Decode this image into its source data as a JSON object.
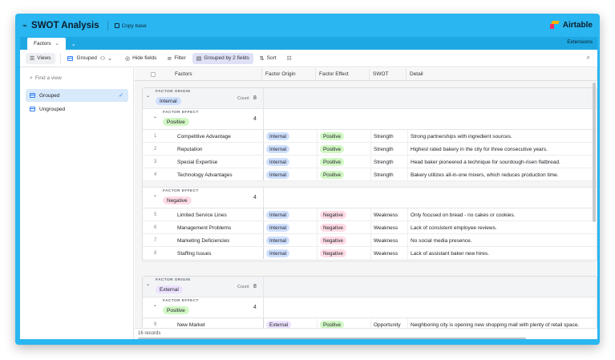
{
  "colors": {
    "header_bg": "#2ab6f0",
    "internal_pill": "#cfe0fe",
    "external_pill": "#ede2fe",
    "positive_pill": "#d1f7c4",
    "negative_pill": "#ffdce5"
  },
  "header": {
    "base_icon": "⌁",
    "title": "SWOT Analysis",
    "copy_base": "Copy base",
    "brand": "Airtable"
  },
  "tabs": {
    "active": "Factors",
    "more_icon": "chevron-down-icon",
    "extensions": "Extensions"
  },
  "toolbar": {
    "views": "Views",
    "view_name": "Grouped",
    "hide_fields": "Hide fields",
    "filter": "Filter",
    "group": "Grouped by 2 fields",
    "sort": "Sort"
  },
  "sidebar": {
    "search_placeholder": "Find a view",
    "views": [
      {
        "label": "Grouped",
        "active": true
      },
      {
        "label": "Ungrouped",
        "active": false
      }
    ]
  },
  "columns": [
    "Factors",
    "Factor Origin",
    "Factor Effect",
    "SWOT",
    "Detail"
  ],
  "groups": [
    {
      "label": "FACTOR ORIGIN",
      "value": "Internal",
      "count_label": "Count",
      "count": "8",
      "subgroups": [
        {
          "label": "FACTOR EFFECT",
          "value": "Positive",
          "count": "4",
          "rows": [
            {
              "n": "1",
              "factor": "Competitive Advantage",
              "origin": "Internal",
              "effect": "Positive",
              "swot": "Strength",
              "detail": "Strong partnerships with ingredient sources."
            },
            {
              "n": "2",
              "factor": "Reputation",
              "origin": "Internal",
              "effect": "Positive",
              "swot": "Strength",
              "detail": "Highest rated bakery in the city for three consecutive years."
            },
            {
              "n": "3",
              "factor": "Special Expertise",
              "origin": "Internal",
              "effect": "Positive",
              "swot": "Strength",
              "detail": "Head baker pioneered a technique for sourdough-risen flatbread."
            },
            {
              "n": "4",
              "factor": "Technology Advantages",
              "origin": "Internal",
              "effect": "Positive",
              "swot": "Strength",
              "detail": "Bakery utilizes all-in-one mixers, which reduces production time."
            }
          ]
        },
        {
          "label": "FACTOR EFFECT",
          "value": "Negative",
          "count": "4",
          "rows": [
            {
              "n": "5",
              "factor": "Limited Service Lines",
              "origin": "Internal",
              "effect": "Negative",
              "swot": "Weakness",
              "detail": "Only focused on bread - no cakes or cookies."
            },
            {
              "n": "6",
              "factor": "Management Problems",
              "origin": "Internal",
              "effect": "Negative",
              "swot": "Weakness",
              "detail": "Lack of consistent employee reviews."
            },
            {
              "n": "7",
              "factor": "Marketing Deficiencies",
              "origin": "Internal",
              "effect": "Negative",
              "swot": "Weakness",
              "detail": "No social media presence."
            },
            {
              "n": "8",
              "factor": "Staffing Issues",
              "origin": "Internal",
              "effect": "Negative",
              "swot": "Weakness",
              "detail": "Lack of assistant baker new hires."
            }
          ]
        }
      ]
    },
    {
      "label": "FACTOR ORIGIN",
      "value": "External",
      "count_label": "Count",
      "count": "8",
      "subgroups": [
        {
          "label": "FACTOR EFFECT",
          "value": "Positive",
          "count": "4",
          "rows": [
            {
              "n": "9",
              "factor": "New Market",
              "origin": "External",
              "effect": "Positive",
              "swot": "Opportunity",
              "detail": "Neighboring city is opening new shopping mall with plenty of retail space."
            }
          ]
        }
      ]
    }
  ],
  "footer": {
    "records": "16 records"
  }
}
